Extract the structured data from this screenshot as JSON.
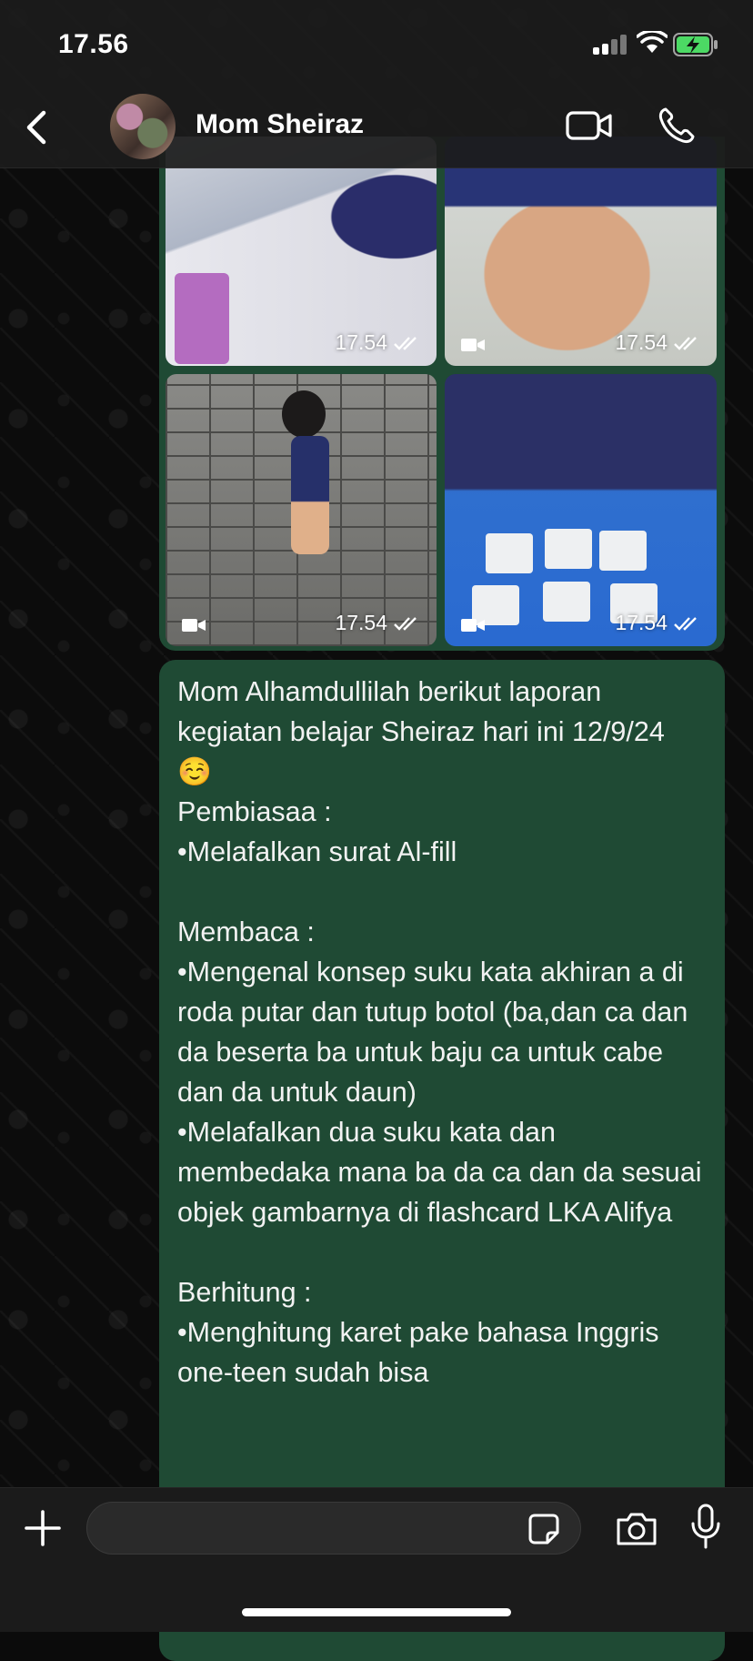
{
  "status_bar": {
    "time": "17.56"
  },
  "header": {
    "contact_name": "Mom Sheiraz",
    "back_icon": "chevron-left-icon",
    "video_icon": "video-call-icon",
    "call_icon": "phone-icon"
  },
  "media": [
    {
      "time": "17.54",
      "type": "video"
    },
    {
      "time": "17.54",
      "type": "video"
    },
    {
      "time": "17.54",
      "type": "video"
    },
    {
      "time": "17.54",
      "type": "video"
    }
  ],
  "message": {
    "text": "Mom Alhamdullilah berikut laporan kegiatan belajar Sheiraz hari ini 12/9/24 ☺️\nPembiasaa :\n•Melafalkan surat Al-fill\n\nMembaca :\n•Mengenal konsep suku kata akhiran a di roda putar dan tutup botol (ba,dan ca dan da beserta ba untuk baju ca untuk cabe dan da untuk daun)\n•Melafalkan dua suku kata dan membedaka mana ba da ca dan da sesuai objek gambarnya di flashcard LKA Alifya\n\nBerhitung :\n•Menghitung karet pake bahasa Inggris one-teen sudah bisa"
  },
  "composer": {
    "input_placeholder": "",
    "icons": [
      "plus-icon",
      "sticker-icon",
      "camera-icon",
      "microphone-icon"
    ]
  },
  "colors": {
    "bubble": "#1f4a34",
    "header": "#1c1c1c",
    "battery_charge": "#4cd964"
  }
}
